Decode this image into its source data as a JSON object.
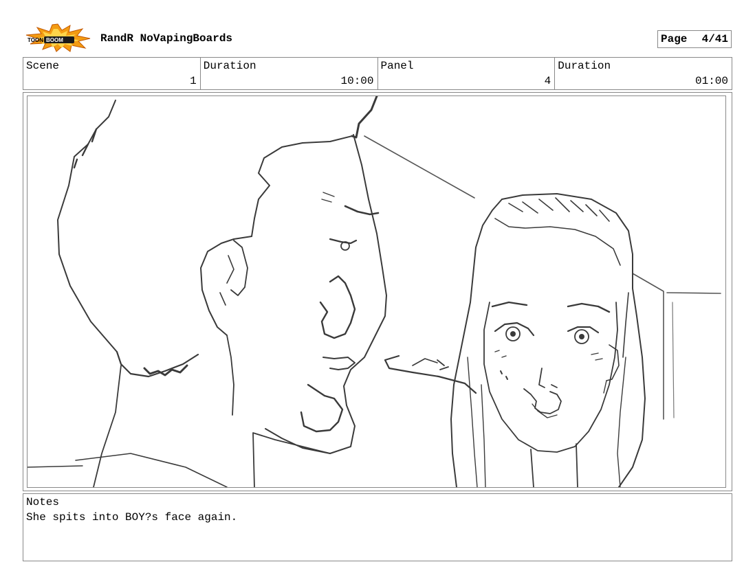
{
  "header": {
    "logo_text": "TOONBOOM",
    "project_title": "RandR NoVapingBoards",
    "page_label": "Page",
    "page_value": "4/41"
  },
  "info": {
    "scene_label": "Scene",
    "scene_value": "1",
    "scene_duration_label": "Duration",
    "scene_duration_value": "10:00",
    "panel_label": "Panel",
    "panel_value": "4",
    "panel_duration_label": "Duration",
    "panel_duration_value": "01:00"
  },
  "panel_image": {
    "icon": "storyboard-sketch"
  },
  "notes": {
    "label": "Notes",
    "text": "She spits into BOY?s face again."
  }
}
